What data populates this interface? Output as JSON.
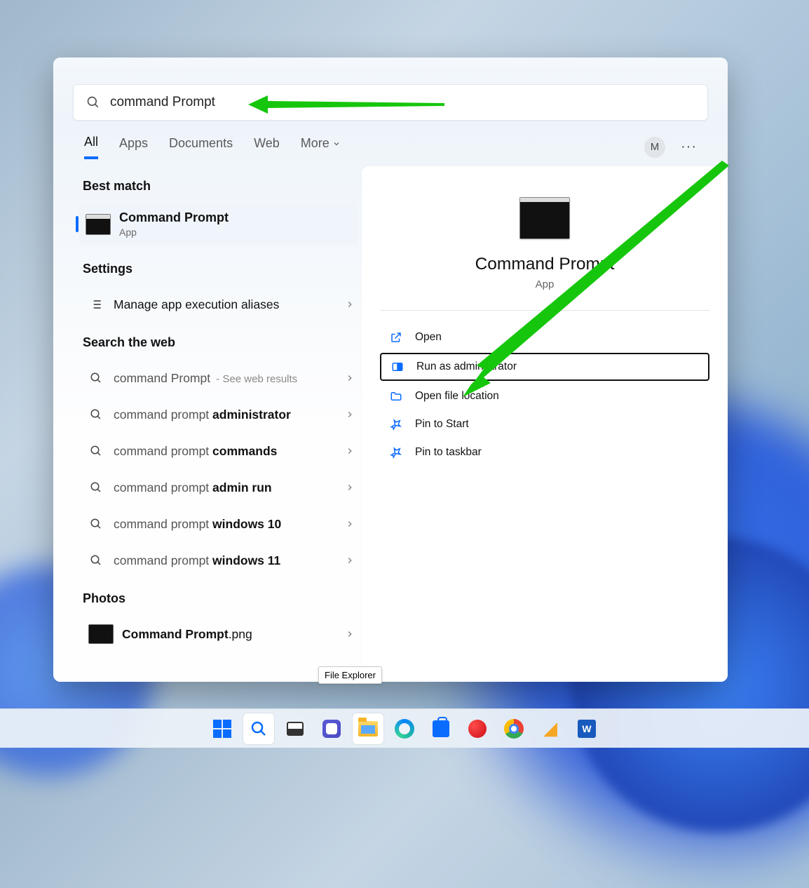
{
  "search": {
    "query": "command Prompt"
  },
  "tabs": {
    "all": "All",
    "apps": "Apps",
    "documents": "Documents",
    "web": "Web",
    "more": "More"
  },
  "user": {
    "initial": "M"
  },
  "sections": {
    "best": "Best match",
    "settings": "Settings",
    "web": "Search the web",
    "photos": "Photos"
  },
  "best_match": {
    "title": "Command Prompt",
    "subtitle": "App"
  },
  "settings_item": {
    "label": "Manage app execution aliases"
  },
  "web_items": [
    {
      "prefix": "command Prompt",
      "bold": "",
      "hint": " - See web results"
    },
    {
      "prefix": "command prompt ",
      "bold": "administrator",
      "hint": ""
    },
    {
      "prefix": "command prompt ",
      "bold": "commands",
      "hint": ""
    },
    {
      "prefix": "command prompt ",
      "bold": "admin run",
      "hint": ""
    },
    {
      "prefix": "command prompt ",
      "bold": "windows 10",
      "hint": ""
    },
    {
      "prefix": "command prompt ",
      "bold": "windows 11",
      "hint": ""
    }
  ],
  "photo_item": {
    "prefix": "Command Prompt",
    "suffix": ".png"
  },
  "detail": {
    "title": "Command Prompt",
    "subtitle": "App"
  },
  "actions": {
    "open": "Open",
    "run_admin": "Run as administrator",
    "open_loc": "Open file location",
    "pin_start": "Pin to Start",
    "pin_taskbar": "Pin to taskbar"
  },
  "tooltip": "File Explorer",
  "taskbar": {
    "word": "W"
  }
}
